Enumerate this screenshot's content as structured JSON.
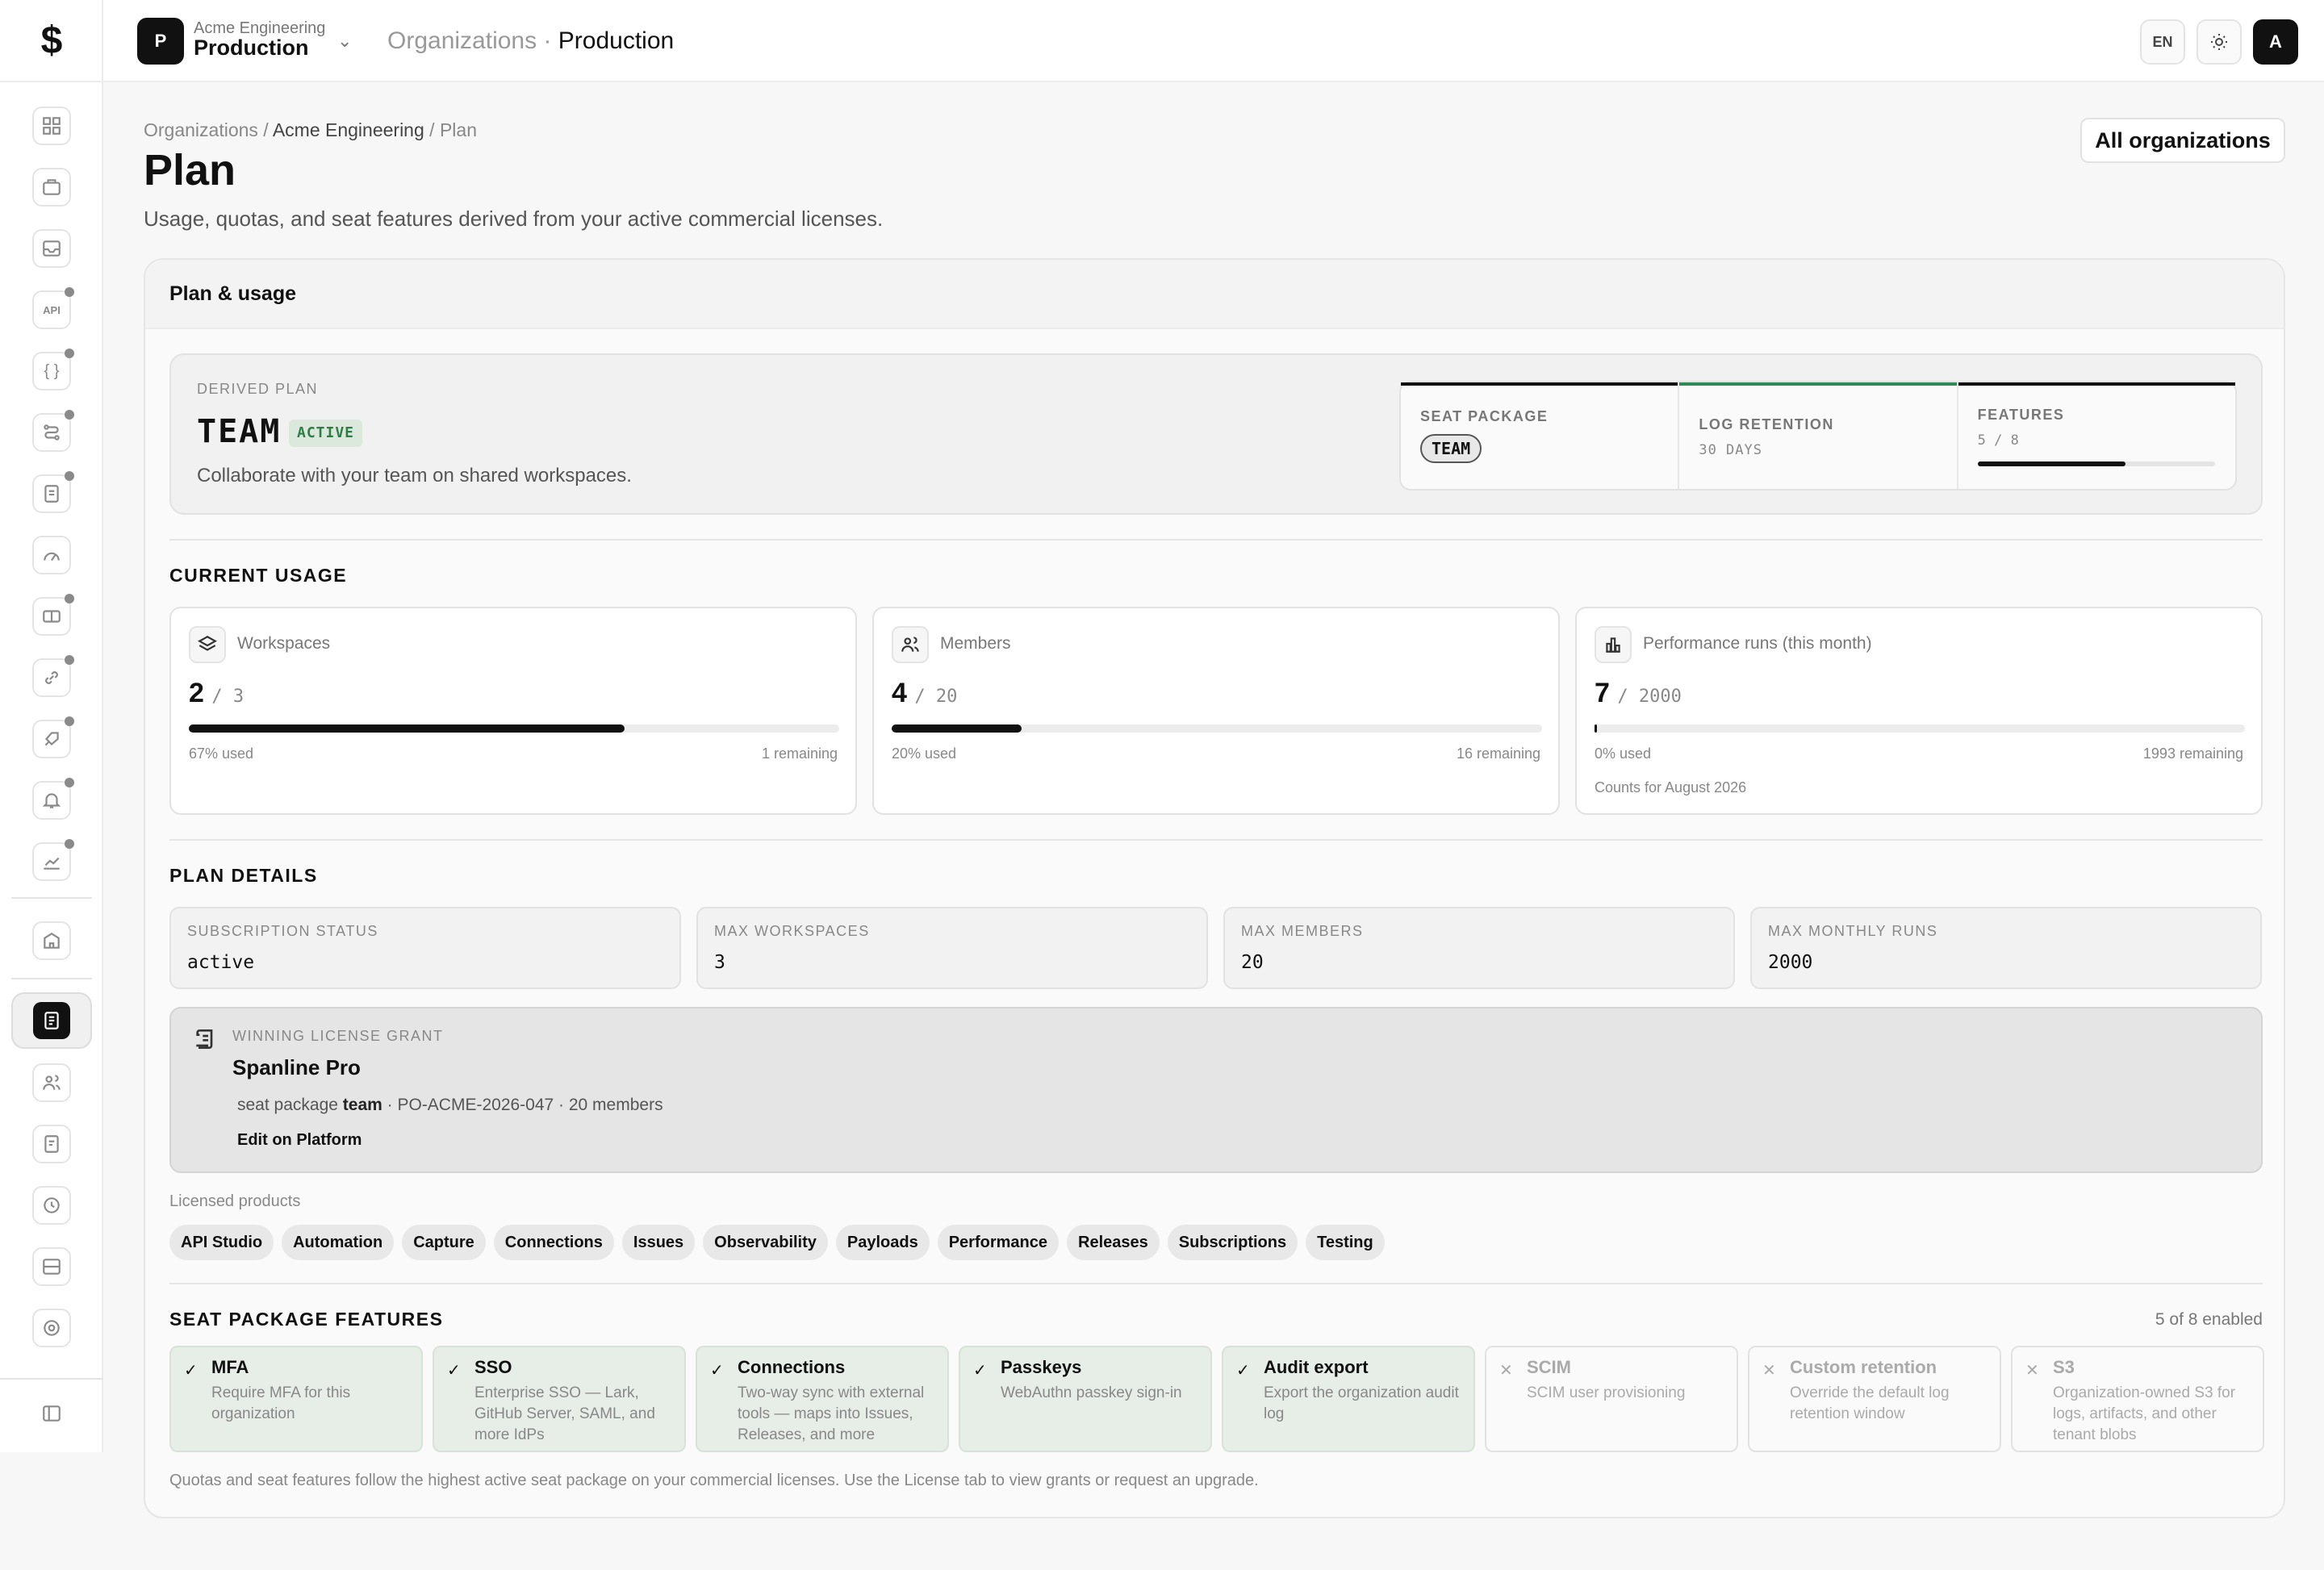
{
  "topbar": {
    "org_initial": "P",
    "org_parent": "Acme Engineering",
    "org_name": "Production",
    "crumb_root": "Organizations",
    "crumb_sep": " · ",
    "crumb_current": "Production",
    "lang": "EN",
    "avatar": "A"
  },
  "page": {
    "breadcrumb_root": "Organizations",
    "breadcrumb_org": "Acme Engineering",
    "breadcrumb_current": "Plan",
    "sep": " / ",
    "title": "Plan",
    "subtitle": "Usage, quotas, and seat features derived from your active commercial licenses.",
    "all_orgs_button": "All organizations"
  },
  "panel": {
    "title": "Plan & usage"
  },
  "derived": {
    "label": "DERIVED PLAN",
    "plan": "TEAM",
    "badge": "ACTIVE",
    "description": "Collaborate with your team on shared workspaces.",
    "seat_label": "SEAT PACKAGE",
    "seat_value": "TEAM",
    "log_label": "LOG RETENTION",
    "log_value": "30 DAYS",
    "features_label": "FEATURES",
    "features_value": "5 / 8",
    "features_fraction": 0.625,
    "colors": {
      "seat": "#111111",
      "log": "#2e8b57",
      "features": "#111111"
    }
  },
  "usage": {
    "title": "CURRENT USAGE",
    "cards": [
      {
        "icon": "layers-icon",
        "label": "Workspaces",
        "value": "2",
        "limit": "3",
        "used_fraction": 0.67,
        "pct": "67% used",
        "remaining": "1 remaining",
        "note": ""
      },
      {
        "icon": "users-icon",
        "label": "Members",
        "value": "4",
        "limit": "20",
        "used_fraction": 0.2,
        "pct": "20% used",
        "remaining": "16 remaining",
        "note": ""
      },
      {
        "icon": "bar-chart-icon",
        "label": "Performance runs (this month)",
        "value": "7",
        "limit": "2000",
        "used_fraction": 0.0035,
        "pct": "0% used",
        "remaining": "1993 remaining",
        "note": "Counts for August 2026"
      }
    ]
  },
  "details": {
    "title": "PLAN DETAILS",
    "cards": [
      {
        "label": "SUBSCRIPTION STATUS",
        "value": "active"
      },
      {
        "label": "MAX WORKSPACES",
        "value": "3"
      },
      {
        "label": "MAX MEMBERS",
        "value": "20"
      },
      {
        "label": "MAX MONTHLY RUNS",
        "value": "2000"
      }
    ]
  },
  "grant": {
    "label": "WINNING LICENSE GRANT",
    "name": "Spanline Pro",
    "meta_prefix": "seat package ",
    "meta_pkg": "team",
    "meta_rest": " · PO-ACME-2026-047 · 20 members",
    "edit": "Edit on Platform"
  },
  "products": {
    "label": "Licensed products",
    "items": [
      "API Studio",
      "Automation",
      "Capture",
      "Connections",
      "Issues",
      "Observability",
      "Payloads",
      "Performance",
      "Releases",
      "Subscriptions",
      "Testing"
    ]
  },
  "features": {
    "title": "SEAT PACKAGE FEATURES",
    "summary": "5 of 8 enabled",
    "items": [
      {
        "name": "MFA",
        "desc": "Require MFA for this organization",
        "enabled": true
      },
      {
        "name": "SSO",
        "desc": "Enterprise SSO — Lark, GitHub Server, SAML, and more IdPs",
        "enabled": true
      },
      {
        "name": "Connections",
        "desc": "Two-way sync with external tools — maps into Issues, Releases, and more",
        "enabled": true
      },
      {
        "name": "Passkeys",
        "desc": "WebAuthn passkey sign-in",
        "enabled": true
      },
      {
        "name": "Audit export",
        "desc": "Export the organization audit log",
        "enabled": true
      },
      {
        "name": "SCIM",
        "desc": "SCIM user provisioning",
        "enabled": false
      },
      {
        "name": "Custom retention",
        "desc": "Override the default log retention window",
        "enabled": false
      },
      {
        "name": "S3",
        "desc": "Organization-owned S3 for logs, artifacts, and other tenant blobs",
        "enabled": false
      }
    ]
  },
  "footer": "Quotas and seat features follow the highest active seat package on your commercial licenses. Use the License tab to view grants or request an upgrade."
}
